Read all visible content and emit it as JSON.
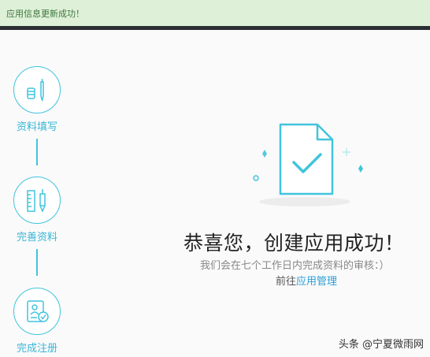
{
  "alert": {
    "text": "应用信息更新成功！"
  },
  "steps": [
    {
      "label": "资料填写",
      "icon": "pencil-icon"
    },
    {
      "label": "完善资料",
      "icon": "ruler-pencil-icon"
    },
    {
      "label": "完成注册",
      "icon": "profile-check-icon"
    }
  ],
  "success": {
    "title": "恭喜您，创建应用成功！",
    "subtitle": "我们会在七个工作日内完成资料的审核：）",
    "goto_prefix": "前往",
    "goto_link": "应用管理"
  },
  "watermark": {
    "text": "头条 @宁夏微雨网"
  },
  "colors": {
    "accent": "#41c4dd",
    "alert_bg": "#dff0d8",
    "alert_text": "#3c763d",
    "link": "#2a9fd6"
  }
}
